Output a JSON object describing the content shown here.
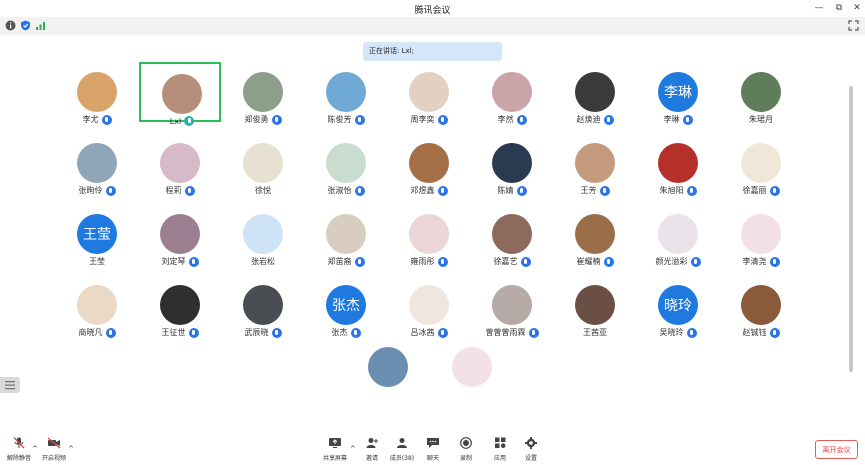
{
  "window": {
    "title": "腾讯会议"
  },
  "window_controls": {
    "minimize": "—",
    "maximize": "⧉",
    "close": "✕"
  },
  "speaking": {
    "label": "正在讲话: ",
    "name": "Lxl;"
  },
  "participants": [
    {
      "name": "李尤",
      "mic": "blue",
      "avatar_color": "#d9a46a"
    },
    {
      "name": "Lxl",
      "mic": "green",
      "avatar_color": "#b78d7b",
      "active": true
    },
    {
      "name": "郑俊勇",
      "mic": "blue",
      "avatar_color": "#8d9f8a"
    },
    {
      "name": "陈俊芳",
      "mic": "blue",
      "avatar_color": "#6fa9d6"
    },
    {
      "name": "周李奕",
      "mic": "blue",
      "avatar_color": "#e2d0c2"
    },
    {
      "name": "李然",
      "mic": "blue",
      "avatar_color": "#caa4a8"
    },
    {
      "name": "赵焕迪",
      "mic": "blue",
      "avatar_color": "#3b3b3b"
    },
    {
      "name": "李琳",
      "mic": "blue",
      "avatar_text": "李琳",
      "avatar_color": "#1f7ae0"
    },
    {
      "name": "朱珺月",
      "mic": "none",
      "avatar_color": "#5f7d5a"
    },
    {
      "name": "张昫伶",
      "mic": "blue",
      "avatar_color": "#8fa6b8"
    },
    {
      "name": "程莉",
      "mic": "blue",
      "avatar_color": "#d7b9c8"
    },
    {
      "name": "徐悦",
      "mic": "none",
      "avatar_color": "#e6e1d0"
    },
    {
      "name": "张淑怡",
      "mic": "blue",
      "avatar_color": "#c8ddd0"
    },
    {
      "name": "邓煜鑫",
      "mic": "blue",
      "avatar_color": "#a57048"
    },
    {
      "name": "陈婧",
      "mic": "blue",
      "avatar_color": "#2a3a50"
    },
    {
      "name": "王芳",
      "mic": "blue",
      "avatar_color": "#c49a7c"
    },
    {
      "name": "朱旭阳",
      "mic": "blue",
      "avatar_color": "#b6302a"
    },
    {
      "name": "徐嘉丽",
      "mic": "blue",
      "avatar_color": "#f1e7d8"
    },
    {
      "name": "王莹",
      "mic": "none",
      "avatar_text": "王莹",
      "avatar_color": "#1f7ae0"
    },
    {
      "name": "刘定琴",
      "mic": "blue",
      "avatar_color": "#9b7f90"
    },
    {
      "name": "张岩松",
      "mic": "none",
      "avatar_color": "#cfe3f7"
    },
    {
      "name": "郑苗裔",
      "mic": "blue",
      "avatar_color": "#d9cdbf"
    },
    {
      "name": "雍雨彤",
      "mic": "blue",
      "avatar_color": "#ead6d6"
    },
    {
      "name": "徐嘉艺",
      "mic": "blue",
      "avatar_color": "#8c6a5c"
    },
    {
      "name": "崔耀楠",
      "mic": "blue",
      "avatar_color": "#9a6e48"
    },
    {
      "name": "颜光溢彩",
      "mic": "blue",
      "avatar_color": "#e9e2e8"
    },
    {
      "name": "李清尧",
      "mic": "blue",
      "avatar_color": "#f2e0e6"
    },
    {
      "name": "商晓凡",
      "mic": "blue",
      "avatar_color": "#e9d9c6"
    },
    {
      "name": "王征世",
      "mic": "blue",
      "avatar_color": "#2f2f2f"
    },
    {
      "name": "武辰晓",
      "mic": "blue",
      "avatar_color": "#4a4d52"
    },
    {
      "name": "张杰",
      "mic": "blue",
      "avatar_text": "张杰",
      "avatar_color": "#1f7ae0"
    },
    {
      "name": "吕冰茜",
      "mic": "blue",
      "avatar_color": "#f0e6e0"
    },
    {
      "name": "曾曾曾雨霖",
      "mic": "blue",
      "avatar_color": "#b5aaa6"
    },
    {
      "name": "王茜亚",
      "mic": "none",
      "avatar_color": "#6b4f45"
    },
    {
      "name": "吴晓玲",
      "mic": "blue",
      "avatar_text": "晓玲",
      "avatar_color": "#1f7ae0"
    },
    {
      "name": "赵铖钰",
      "mic": "blue",
      "avatar_color": "#8a5a3a"
    }
  ],
  "extra_avatars": [
    {
      "avatar_color": "#6a8fb0"
    },
    {
      "avatar_color": "#f3e1e6"
    }
  ],
  "toolbar": {
    "unmute": "解除静音",
    "start_video": "开启视频",
    "share_screen": "共享屏幕",
    "invite": "邀请",
    "members": "成员(38)",
    "chat": "聊天",
    "record": "录制",
    "apps": "应用",
    "settings": "设置",
    "leave": "离开会议"
  },
  "colors": {
    "accent": "#1f7ae0",
    "active_border": "#29c058",
    "leave": "#e04545"
  }
}
